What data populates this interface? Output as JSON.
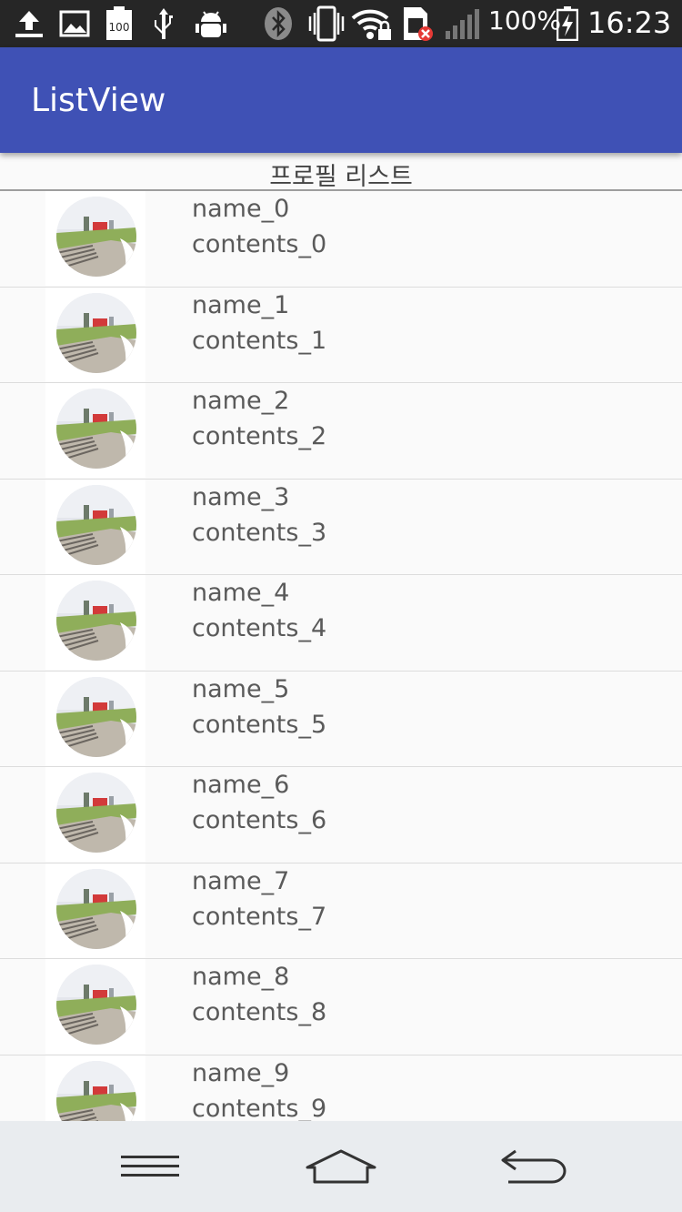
{
  "status_bar": {
    "battery_level": "100",
    "battery_percent": "100%",
    "time": "16:23",
    "icons": [
      "upload-icon",
      "image-icon",
      "battery-100-icon",
      "usb-icon",
      "android-debug-icon",
      "bluetooth-icon",
      "vibrate-icon",
      "wifi-lock-icon",
      "sim-error-icon",
      "signal-icon",
      "charging-battery-icon"
    ]
  },
  "app_bar": {
    "title": "ListView"
  },
  "list_header": {
    "label": "프로필 리스트"
  },
  "list": {
    "items": [
      {
        "name": "name_0",
        "contents": "contents_0"
      },
      {
        "name": "name_1",
        "contents": "contents_1"
      },
      {
        "name": "name_2",
        "contents": "contents_2"
      },
      {
        "name": "name_3",
        "contents": "contents_3"
      },
      {
        "name": "name_4",
        "contents": "contents_4"
      },
      {
        "name": "name_5",
        "contents": "contents_5"
      },
      {
        "name": "name_6",
        "contents": "contents_6"
      },
      {
        "name": "name_7",
        "contents": "contents_7"
      },
      {
        "name": "name_8",
        "contents": "contents_8"
      },
      {
        "name": "name_9",
        "contents": "contents_9"
      }
    ]
  },
  "nav_bar": {
    "buttons": [
      "menu-icon",
      "home-icon",
      "back-icon"
    ]
  },
  "colors": {
    "app_bar": "#3f51b5",
    "status_bar": "#262626",
    "background": "#fafafa",
    "nav_bar": "#e9ecef"
  }
}
